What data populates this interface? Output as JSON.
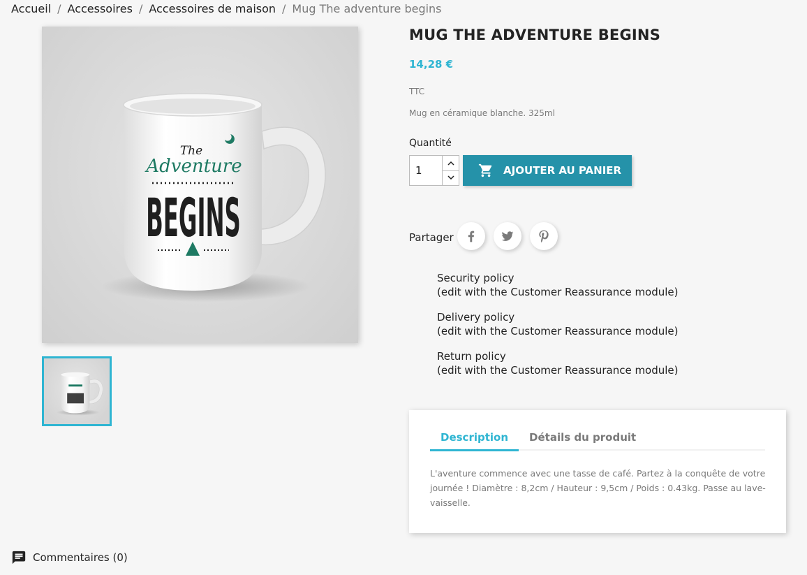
{
  "breadcrumb": {
    "items": [
      "Accueil",
      "Accessoires",
      "Accessoires de maison"
    ],
    "current": "Mug The adventure begins",
    "separator": "/"
  },
  "product": {
    "title": "Mug The adventure begins",
    "price": "14,28 €",
    "tax_label": "TTC",
    "short_description": "Mug en céramique blanche. 325ml",
    "image_text": {
      "line1": "The",
      "line2": "Adventure",
      "line3": "BEGINS"
    }
  },
  "purchase": {
    "quantity_label": "Quantité",
    "quantity_value": "1",
    "add_to_cart_label": "Ajouter au panier"
  },
  "share": {
    "label": "Partager",
    "networks": [
      "facebook-icon",
      "twitter-icon",
      "pinterest-icon"
    ]
  },
  "reassurance": [
    {
      "title": "Security policy",
      "subtitle": "(edit with the Customer Reassurance module)"
    },
    {
      "title": "Delivery policy",
      "subtitle": "(edit with the Customer Reassurance module)"
    },
    {
      "title": "Return policy",
      "subtitle": "(edit with the Customer Reassurance module)"
    }
  ],
  "tabs": {
    "items": [
      "Description",
      "Détails du produit"
    ],
    "active": "Description",
    "content": "L'aventure commence avec une tasse de café. Partez à la conquête de votre journée ! Diamètre : 8,2cm / Hauteur : 9,5cm / Poids : 0.43kg. Passe au lave-vaisselle."
  },
  "comments": {
    "label": "Commentaires (0)"
  },
  "colors": {
    "accent": "#2fb5d2",
    "button": "#2592a9",
    "mug_green": "#1e7a63",
    "text": "#232323",
    "muted": "#7a7a7a"
  }
}
